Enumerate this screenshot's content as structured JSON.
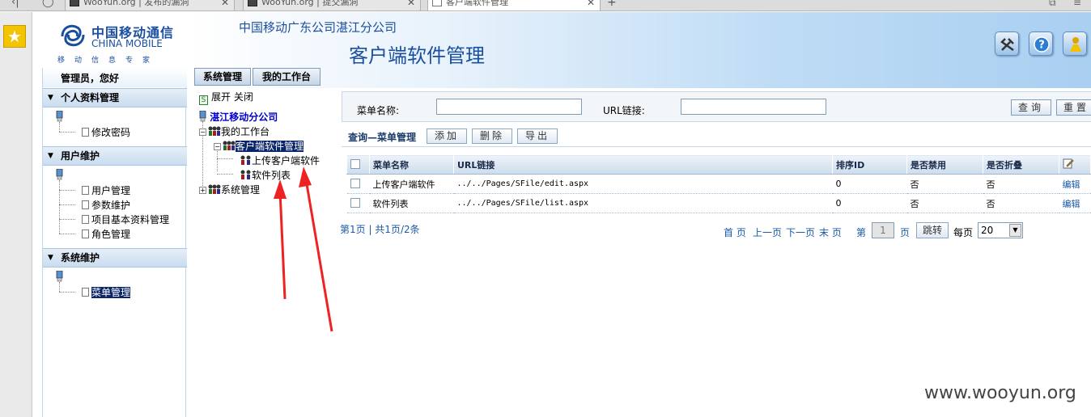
{
  "browser": {
    "tabs": [
      {
        "label": "WooYun.org | 发布的漏洞",
        "active": false
      },
      {
        "label": "WooYun.org | 提交漏洞",
        "active": false
      },
      {
        "label": "客户端软件管理",
        "active": true
      }
    ]
  },
  "header": {
    "logo_cn": "中国移动通信",
    "logo_en": "CHINA MOBILE",
    "logo_slogan": "移动信息专家",
    "company": "中国移动广东公司湛江分公司",
    "title": "客户端软件管理",
    "icons": [
      "tools-icon",
      "help-icon",
      "user-key-icon"
    ]
  },
  "left_menu": {
    "welcome": "管理员，您好",
    "groups": [
      {
        "title": "个人资料管理",
        "items": [
          "修改密码"
        ]
      },
      {
        "title": "用户维护",
        "items": [
          "用户管理",
          "参数维护",
          "项目基本资料管理",
          "角色管理"
        ]
      },
      {
        "title": "系统维护",
        "items": [
          "菜单管理"
        ],
        "selected": "菜单管理"
      }
    ]
  },
  "mid_panel": {
    "tabs": [
      "系统管理",
      "我的工作台"
    ],
    "toolbar": {
      "expand": "展开",
      "close": "关闭"
    },
    "tree": {
      "root": "湛江移动分公司",
      "nodes": [
        "我的工作台",
        "客户端软件管理",
        "上传客户端软件",
        "软件列表",
        "系统管理"
      ]
    }
  },
  "search": {
    "menu_name_label": "菜单名称:",
    "url_label": "URL链接:",
    "menu_name_value": "",
    "url_value": "",
    "query_button": "查询",
    "reset_button": "重置"
  },
  "query": {
    "title": "查询—菜单管理",
    "add_button": "添加",
    "delete_button": "删除",
    "export_button": "导出"
  },
  "grid": {
    "headers": [
      "菜单名称",
      "URL链接",
      "排序ID",
      "是否禁用",
      "是否折叠"
    ],
    "rows": [
      {
        "name": "上传客户端软件",
        "url": "../../Pages/SFile/edit.aspx",
        "sort": "0",
        "disabled": "否",
        "folded": "否",
        "action": "编辑"
      },
      {
        "name": "软件列表",
        "url": "../../Pages/SFile/list.aspx",
        "sort": "0",
        "disabled": "否",
        "folded": "否",
        "action": "编辑"
      }
    ]
  },
  "pager": {
    "summary": "第1页 | 共1页/2条",
    "first": "首 页",
    "prev": "上一页",
    "next": "下一页",
    "last": "末 页",
    "page_label": "第",
    "page_value": "1",
    "page_suffix": "页",
    "jump_button": "跳转",
    "per_page_label": "每页",
    "per_page_value": "20"
  },
  "watermark": "www.wooyun.org",
  "colors": {
    "accent": "#1a4fa0",
    "selection": "#0a246a",
    "annotation_arrow": "#ee2222"
  }
}
